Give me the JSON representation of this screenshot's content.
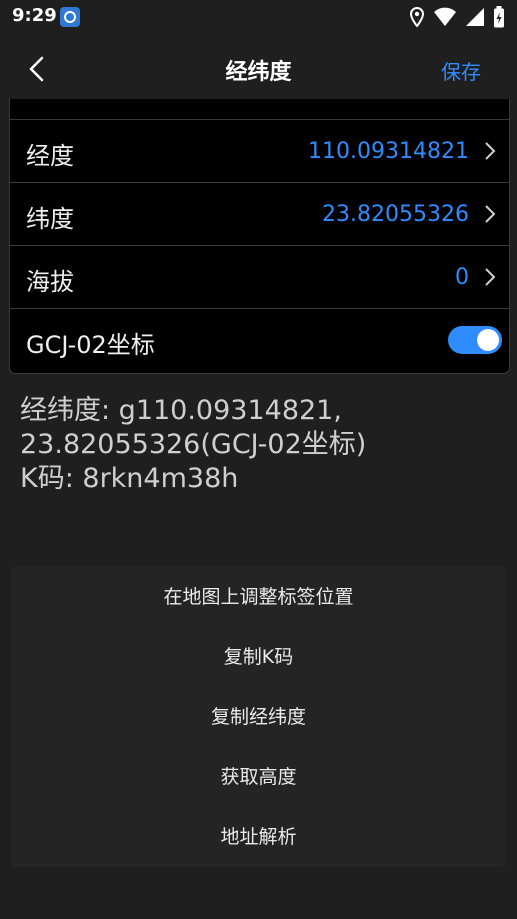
{
  "status": {
    "time": "9:29"
  },
  "header": {
    "title": "经纬度",
    "save_label": "保存"
  },
  "fields": [
    {
      "label": "经度",
      "value": "110.09314821"
    },
    {
      "label": "纬度",
      "value": "23.82055326"
    },
    {
      "label": "海拔",
      "value": "0"
    }
  ],
  "gcj": {
    "label": "GCJ-02坐标",
    "enabled": true
  },
  "info": {
    "line1": "经纬度: g110.09314821,",
    "line2": "23.82055326(GCJ-02坐标)",
    "line3": "K码: 8rkn4m38h"
  },
  "actions": [
    {
      "label": "在地图上调整标签位置"
    },
    {
      "label": "复制K码"
    },
    {
      "label": "复制经纬度"
    },
    {
      "label": "获取高度"
    },
    {
      "label": "地址解析"
    }
  ],
  "colors": {
    "accent": "#2f8cff",
    "background": "#1f1f1f",
    "card": "#000000"
  }
}
